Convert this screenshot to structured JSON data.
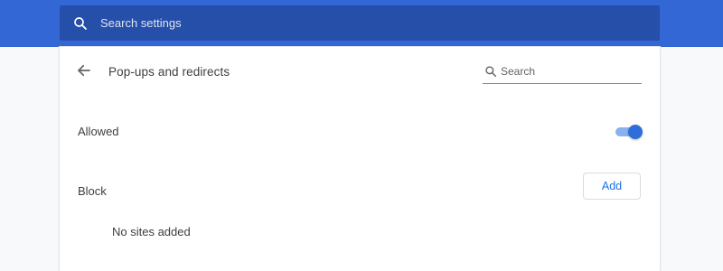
{
  "topbar": {
    "search_placeholder": "Search settings",
    "search_icon": "search-icon",
    "color": "#3367d6",
    "search_box_color": "#254fa8"
  },
  "page": {
    "back_icon": "back-arrow-icon",
    "title": "Pop-ups and redirects",
    "search_placeholder": "Search",
    "search_icon": "search-icon"
  },
  "allowed": {
    "label": "Allowed",
    "toggle_on": true,
    "accent_color": "#2f6ed8"
  },
  "block": {
    "label": "Block",
    "add_label": "Add",
    "empty_text": "No sites added"
  }
}
